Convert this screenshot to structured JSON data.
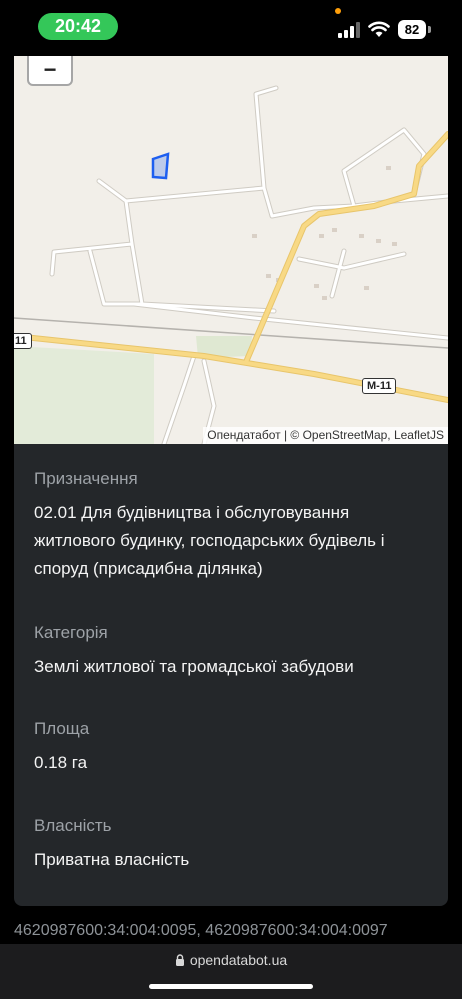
{
  "status_bar": {
    "time": "20:42",
    "battery": "82",
    "time_pill_color": "#34c759"
  },
  "map": {
    "zoom_out": "−",
    "attribution": "Опендатабот | © OpenStreetMap, LeafletJS",
    "road_labels": {
      "m11": "M-11",
      "m11_left": "11"
    },
    "parcel_color": "#1e5ff0"
  },
  "info": {
    "purpose_label": "Призначення",
    "purpose_value": "02.01 Для будівництва і обслуговування житлового будинку, господарських будівель і споруд (присадибна ділянка)",
    "category_label": "Категорія",
    "category_value": "Землі житлової та громадської забудови",
    "area_label": "Площа",
    "area_value": "0.18 га",
    "ownership_label": "Власність",
    "ownership_value": "Приватна власність"
  },
  "cadastral_numbers": "4620987600:34:004:0095, 4620987600:34:004:0097",
  "browser": {
    "url": "opendatabot.ua"
  }
}
